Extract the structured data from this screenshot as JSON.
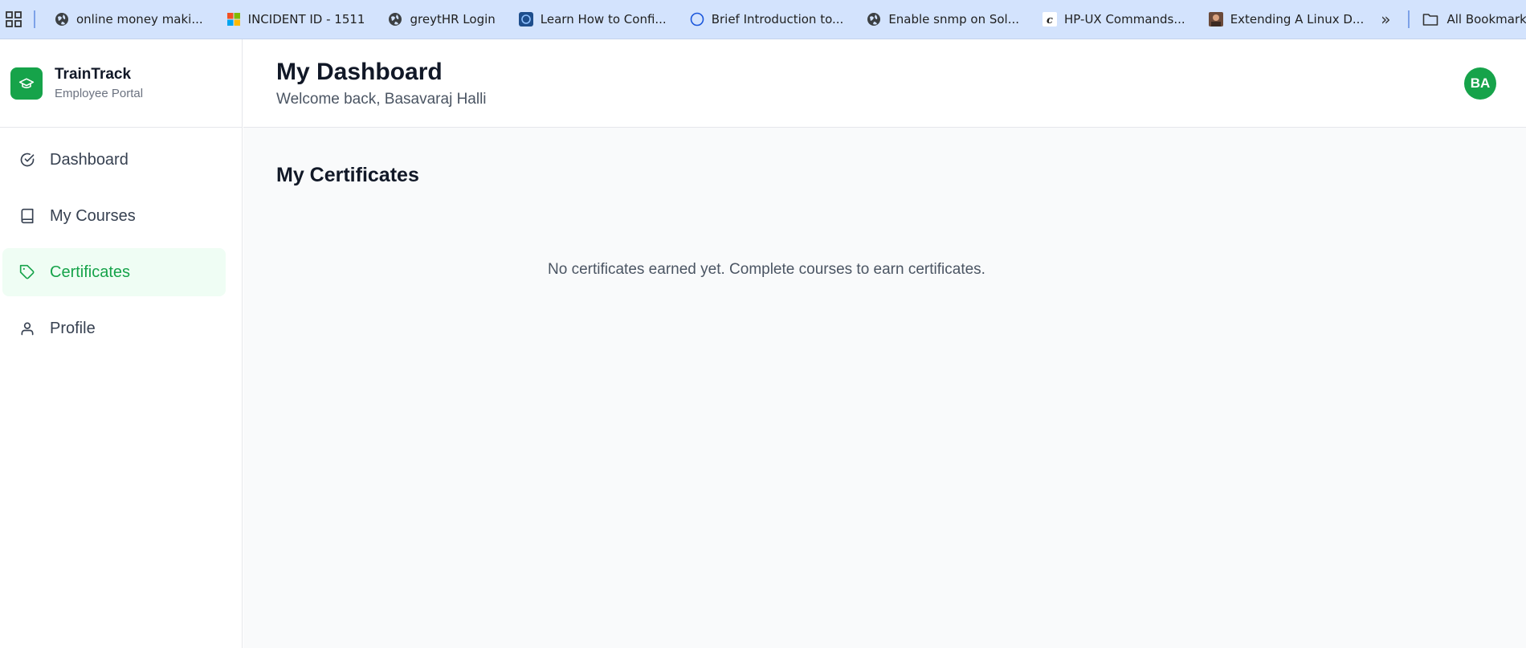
{
  "browser": {
    "bookmarks": [
      {
        "label": "online money maki...",
        "icon": "globe-icon"
      },
      {
        "label": "INCIDENT ID - 1511",
        "icon": "microsoft-icon"
      },
      {
        "label": "greytHR Login",
        "icon": "globe-icon"
      },
      {
        "label": "Learn How to Confi...",
        "icon": "site-icon"
      },
      {
        "label": "Brief Introduction to...",
        "icon": "circle-icon"
      },
      {
        "label": "Enable snmp on Sol...",
        "icon": "globe-icon"
      },
      {
        "label": "HP-UX Commands...",
        "icon": "c-icon"
      },
      {
        "label": "Extending A Linux D...",
        "icon": "photo-icon"
      }
    ],
    "all_bookmarks_label": "All Bookmarks"
  },
  "brand": {
    "name": "TrainTrack",
    "subtitle": "Employee Portal"
  },
  "sidebar": {
    "items": [
      {
        "label": "Dashboard",
        "icon": "check-circle-icon",
        "active": false
      },
      {
        "label": "My Courses",
        "icon": "book-icon",
        "active": false
      },
      {
        "label": "Certificates",
        "icon": "tag-icon",
        "active": true
      },
      {
        "label": "Profile",
        "icon": "user-icon",
        "active": false
      }
    ]
  },
  "header": {
    "title": "My Dashboard",
    "welcome": "Welcome back, Basavaraj Halli",
    "avatar_initials": "BA"
  },
  "main": {
    "section_title": "My Certificates",
    "empty_message": "No certificates earned yet. Complete courses to earn certificates."
  },
  "colors": {
    "accent": "#16a34a",
    "active_bg": "#effdf4",
    "bookmarks_bar": "#d3e3fd"
  }
}
